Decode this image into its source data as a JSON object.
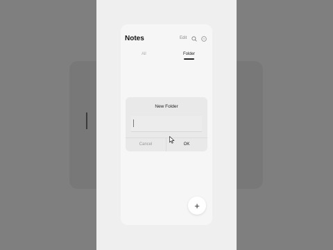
{
  "header": {
    "title": "Notes",
    "edit_label": "Edit"
  },
  "tabs": [
    {
      "label": "All",
      "active": false
    },
    {
      "label": "Folder",
      "active": true
    }
  ],
  "dialog": {
    "title": "New Folder",
    "input_value": "",
    "cancel_label": "Cancel",
    "ok_label": "OK"
  },
  "fab": {
    "label": "+"
  },
  "icons": {
    "search": "search-icon",
    "more": "more-icon",
    "cursor": "mouse-cursor-icon"
  }
}
